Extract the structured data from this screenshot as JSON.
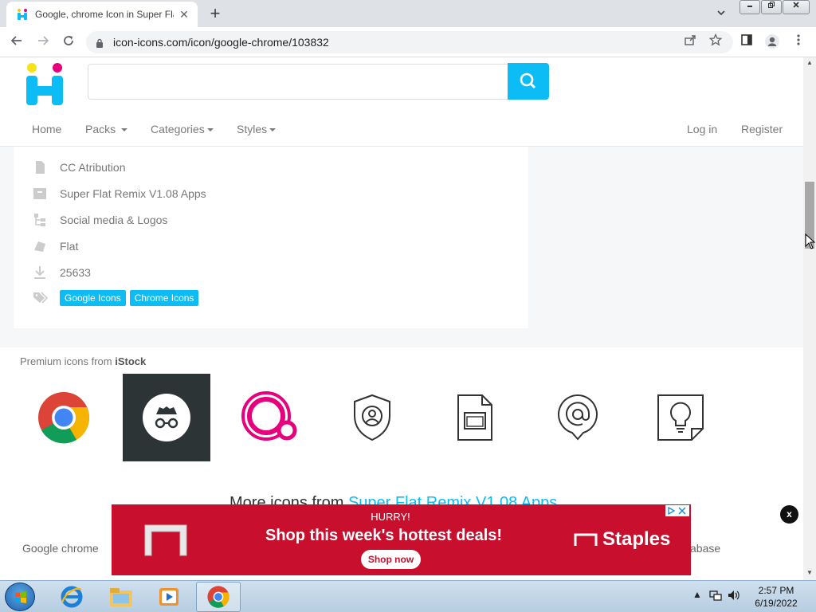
{
  "browser": {
    "tab_title": "Google, chrome Icon in Super Fla",
    "close_glyph": "✕",
    "new_tab_glyph": "+",
    "url": "icon-icons.com/icon/google-chrome/103832"
  },
  "site": {
    "nav": {
      "home": "Home",
      "packs": "Packs",
      "categories": "Categories",
      "styles": "Styles",
      "login": "Log in",
      "register": "Register"
    },
    "search": {
      "placeholder": ""
    },
    "info": {
      "license": "CC Atribution",
      "pack": "Super Flat Remix V1.08 Apps",
      "category": "Social media & Logos",
      "style": "Flat",
      "downloads": "25633",
      "tags": [
        "Google Icons",
        "Chrome Icons"
      ]
    },
    "premium": {
      "label": "Premium icons from ",
      "source": "iStock",
      "icons": [
        "chrome-logo-icon",
        "incognito-icon",
        "quake-ring-icon",
        "user-shield-icon",
        "slides-file-icon",
        "at-sign-pin-icon",
        "lightbulb-note-icon"
      ]
    },
    "more_icons": {
      "prefix": "More icons from ",
      "pack": "Super Flat Remix V1.08 Apps"
    },
    "bottom_left_label": "Google chrome",
    "bottom_right_label": "abase"
  },
  "ad": {
    "hurry": "HURRY!",
    "headline": "Shop this week's hottest deals!",
    "cta": "Shop now",
    "brand": "Staples",
    "close": "x"
  },
  "taskbar": {
    "time": "2:57 PM",
    "date": "6/19/2022"
  },
  "colors": {
    "accent": "#0cbcf4",
    "ad_red": "#c8102e"
  }
}
